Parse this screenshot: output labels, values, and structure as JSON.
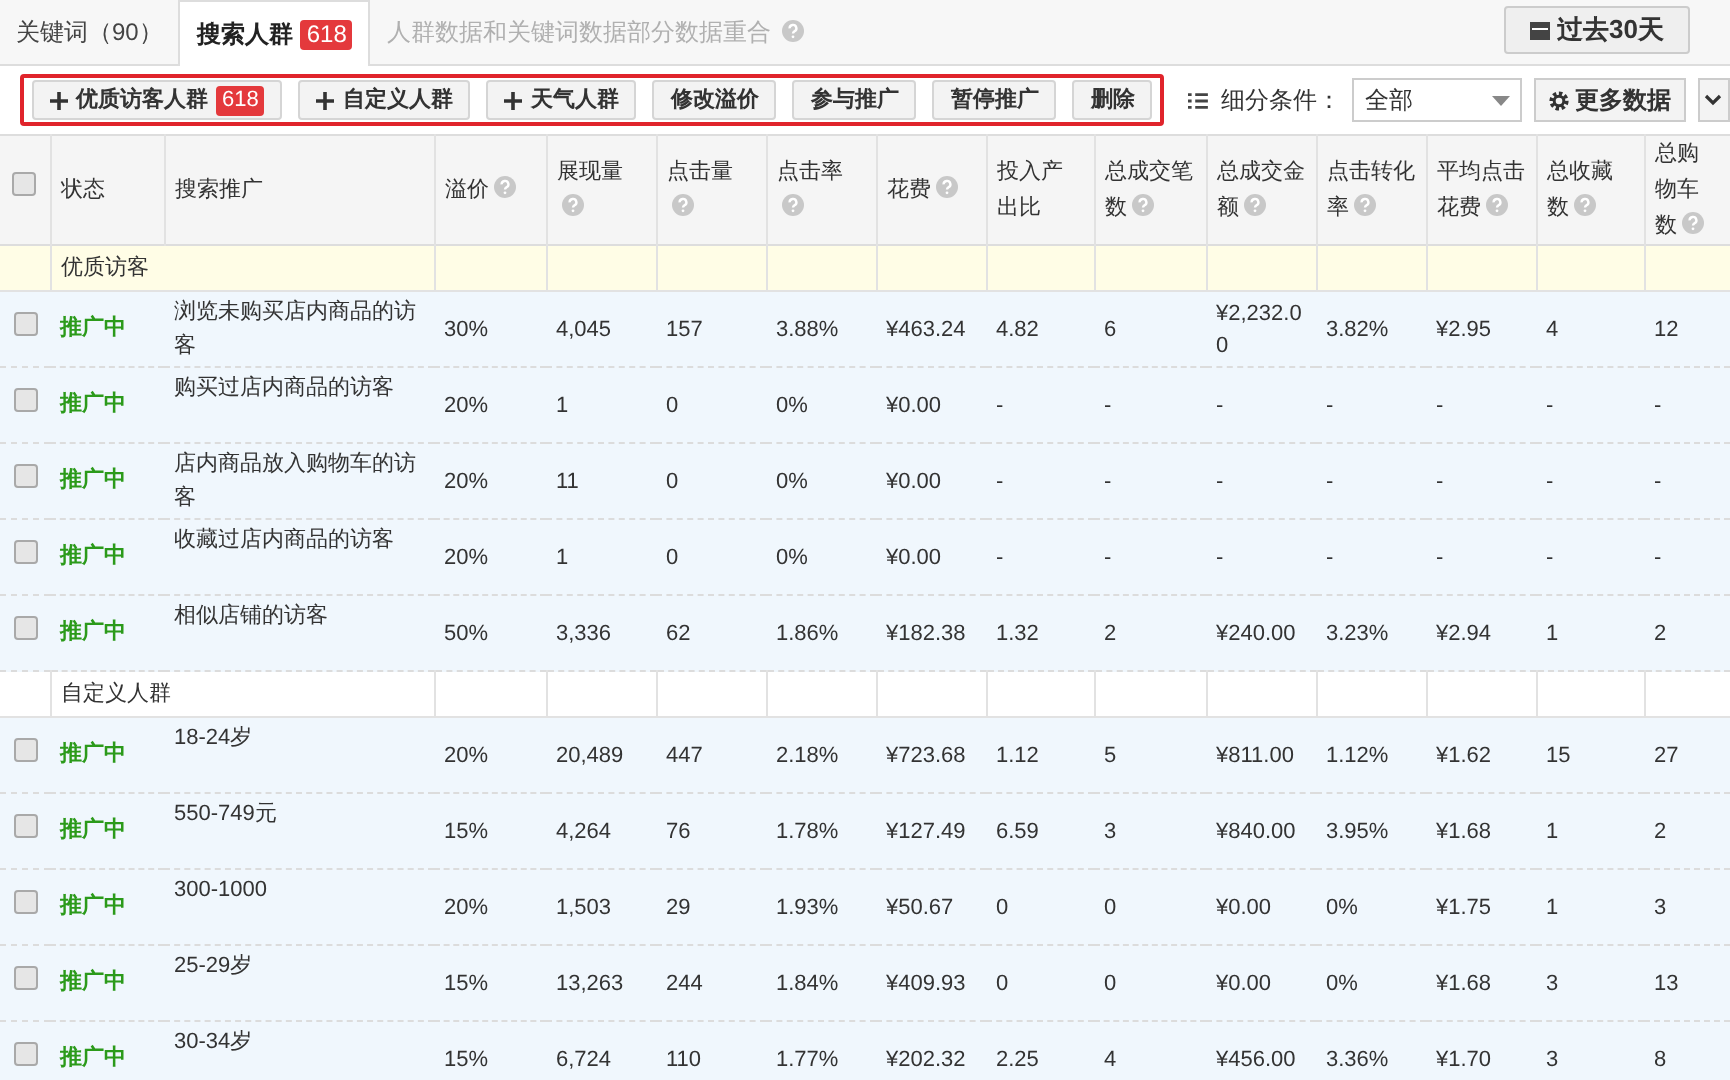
{
  "tabs": [
    {
      "label": "关键词（90）",
      "selected": false
    },
    {
      "label": "搜索人群",
      "badge": "618",
      "selected": true
    }
  ],
  "tab_hint": "人群数据和关键词数据部分数据重合",
  "date_button": "过去30天",
  "toolbar": {
    "buttons": [
      {
        "label": "优质访客人群",
        "badge": "618",
        "kind": "add"
      },
      {
        "label": "自定义人群",
        "kind": "add"
      },
      {
        "label": "天气人群",
        "kind": "add"
      },
      {
        "label": "修改溢价",
        "kind": "plain"
      },
      {
        "label": "参与推广",
        "kind": "plain"
      },
      {
        "label": "暂停推广",
        "kind": "plain"
      },
      {
        "label": "删除",
        "kind": "plain"
      }
    ],
    "filter_label": "细分条件：",
    "filter_value": "全部",
    "more_button": "更多数据"
  },
  "table": {
    "header_checked": false,
    "columns": [
      {
        "label": "状态",
        "help": false
      },
      {
        "label": "搜索推广",
        "help": false
      },
      {
        "label": "溢价",
        "help": true
      },
      {
        "label": "展现量",
        "help": true
      },
      {
        "label": "点击量",
        "help": true
      },
      {
        "label": "点击率",
        "help": true
      },
      {
        "label": "花费",
        "help": true
      },
      {
        "label": "投入产出比",
        "help": false
      },
      {
        "label": "总成交笔数",
        "help": true
      },
      {
        "label": "总成交金额",
        "help": true
      },
      {
        "label": "点击转化率",
        "help": true
      },
      {
        "label": "平均点击花费",
        "help": true
      },
      {
        "label": "总收藏数",
        "help": true
      },
      {
        "label": "总购物车数",
        "help": true
      }
    ],
    "groups": [
      {
        "title": "优质访客",
        "rows": [
          {
            "checked": false,
            "status": "推广中",
            "name": "浏览未购买店内商品的访客",
            "cells": [
              "30%",
              "4,045",
              "157",
              "3.88%",
              "¥463.24",
              "4.82",
              "6",
              "¥2,232.00",
              "3.82%",
              "¥2.95",
              "4",
              "12"
            ]
          },
          {
            "checked": false,
            "status": "推广中",
            "name": "购买过店内商品的访客",
            "cells": [
              "20%",
              "1",
              "0",
              "0%",
              "¥0.00",
              "-",
              "-",
              "-",
              "-",
              "-",
              "-",
              "-"
            ]
          },
          {
            "checked": false,
            "status": "推广中",
            "name": "店内商品放入购物车的访客",
            "cells": [
              "20%",
              "11",
              "0",
              "0%",
              "¥0.00",
              "-",
              "-",
              "-",
              "-",
              "-",
              "-",
              "-"
            ]
          },
          {
            "checked": false,
            "status": "推广中",
            "name": "收藏过店内商品的访客",
            "cells": [
              "20%",
              "1",
              "0",
              "0%",
              "¥0.00",
              "-",
              "-",
              "-",
              "-",
              "-",
              "-",
              "-"
            ]
          },
          {
            "checked": false,
            "status": "推广中",
            "name": "相似店铺的访客",
            "cells": [
              "50%",
              "3,336",
              "62",
              "1.86%",
              "¥182.38",
              "1.32",
              "2",
              "¥240.00",
              "3.23%",
              "¥2.94",
              "1",
              "2"
            ]
          }
        ]
      },
      {
        "title": "自定义人群",
        "rows": [
          {
            "checked": false,
            "status": "推广中",
            "name": "18-24岁",
            "cells": [
              "20%",
              "20,489",
              "447",
              "2.18%",
              "¥723.68",
              "1.12",
              "5",
              "¥811.00",
              "1.12%",
              "¥1.62",
              "15",
              "27"
            ]
          },
          {
            "checked": false,
            "status": "推广中",
            "name": "550-749元",
            "cells": [
              "15%",
              "4,264",
              "76",
              "1.78%",
              "¥127.49",
              "6.59",
              "3",
              "¥840.00",
              "3.95%",
              "¥1.68",
              "1",
              "2"
            ]
          },
          {
            "checked": false,
            "status": "推广中",
            "name": "300-1000",
            "cells": [
              "20%",
              "1,503",
              "29",
              "1.93%",
              "¥50.67",
              "0",
              "0",
              "¥0.00",
              "0%",
              "¥1.75",
              "1",
              "3"
            ]
          },
          {
            "checked": false,
            "status": "推广中",
            "name": "25-29岁",
            "cells": [
              "15%",
              "13,263",
              "244",
              "1.84%",
              "¥409.93",
              "0",
              "0",
              "¥0.00",
              "0%",
              "¥1.68",
              "3",
              "13"
            ]
          },
          {
            "checked": false,
            "status": "推广中",
            "name": "30-34岁",
            "cells": [
              "15%",
              "6,724",
              "110",
              "1.77%",
              "¥202.32",
              "2.25",
              "4",
              "¥456.00",
              "3.36%",
              "¥1.70",
              "3",
              "8"
            ]
          }
        ]
      }
    ]
  }
}
